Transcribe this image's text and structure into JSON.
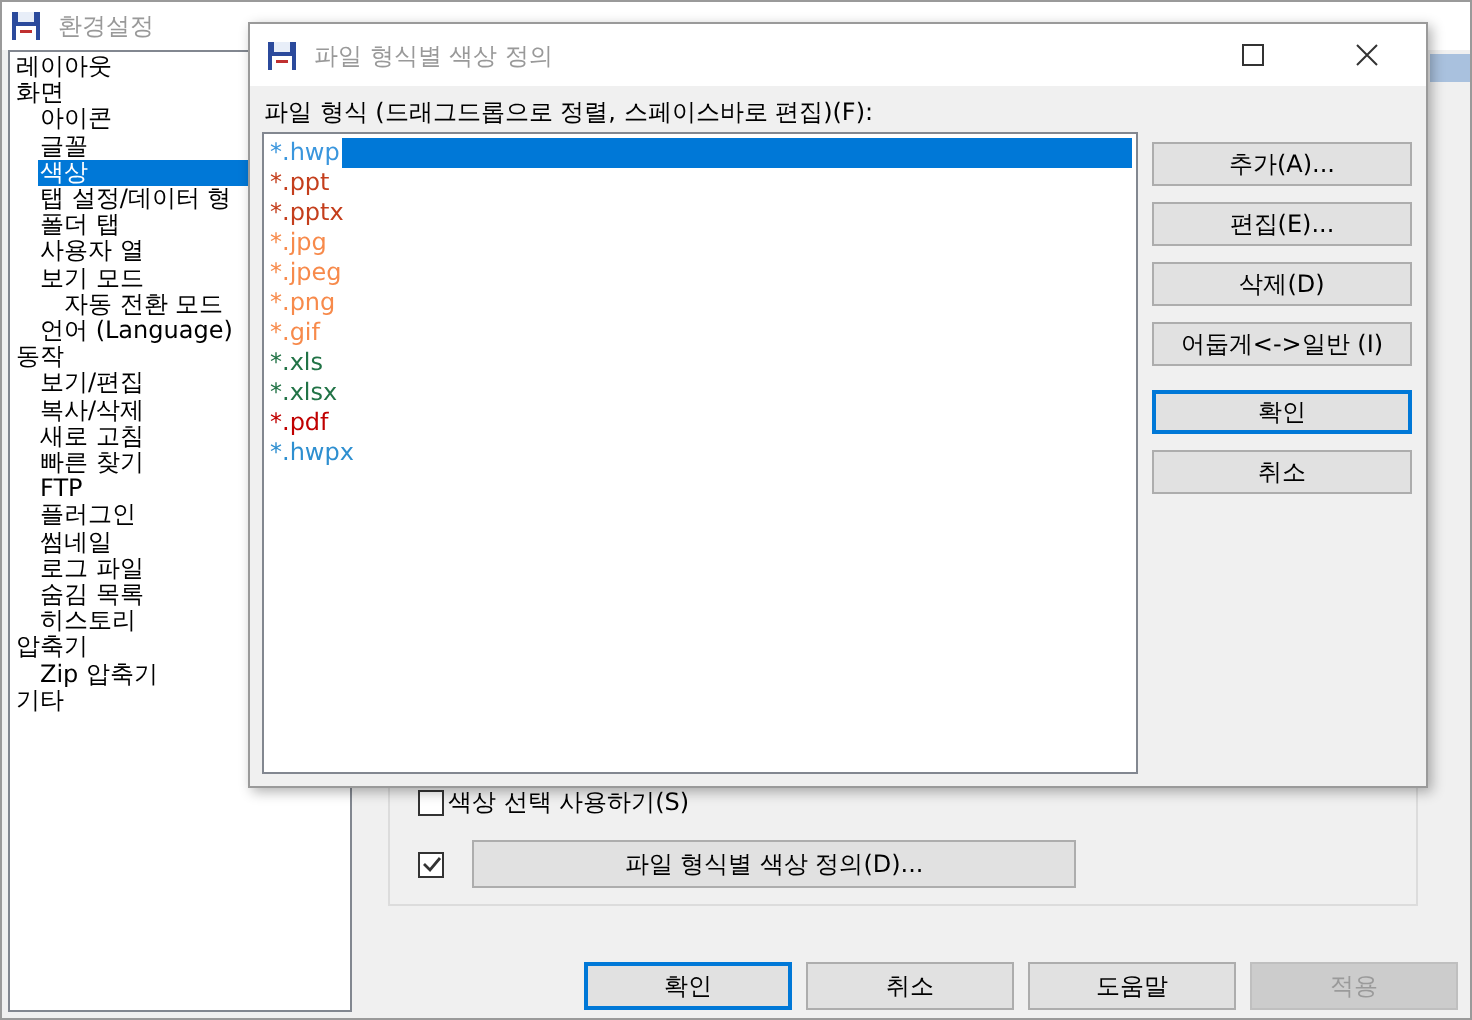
{
  "window": {
    "title": "환경설정"
  },
  "tree": [
    {
      "label": "레이아웃",
      "selected": false
    },
    {
      "label": "화면",
      "selected": false,
      "children": [
        {
          "label": "아이콘",
          "selected": false
        },
        {
          "label": "글꼴",
          "selected": false
        },
        {
          "label": "색상",
          "selected": true
        },
        {
          "label": "탭 설정/데이터 형",
          "selected": false
        },
        {
          "label": "폴더 탭",
          "selected": false
        },
        {
          "label": "사용자 열",
          "selected": false
        },
        {
          "label": "보기 모드",
          "selected": false,
          "children": [
            {
              "label": "자동 전환 모드",
              "selected": false
            }
          ]
        },
        {
          "label": "언어 (Language)",
          "selected": false
        }
      ]
    },
    {
      "label": "동작",
      "selected": false,
      "children": [
        {
          "label": "보기/편집",
          "selected": false
        },
        {
          "label": "복사/삭제",
          "selected": false
        },
        {
          "label": "새로 고침",
          "selected": false
        },
        {
          "label": "빠른 찾기",
          "selected": false
        },
        {
          "label": "FTP",
          "selected": false
        },
        {
          "label": "플러그인",
          "selected": false
        },
        {
          "label": "썸네일",
          "selected": false
        },
        {
          "label": "로그 파일",
          "selected": false
        },
        {
          "label": "숨김 목록",
          "selected": false
        },
        {
          "label": "히스토리",
          "selected": false
        }
      ]
    },
    {
      "label": "압축기",
      "selected": false,
      "children": [
        {
          "label": "Zip 압축기",
          "selected": false
        }
      ]
    },
    {
      "label": "기타",
      "selected": false
    }
  ],
  "options": [
    {
      "label": "색상 선택 사용하기(S)",
      "checked": false
    },
    {
      "label": "파일 형식별 색상 정의(D)...",
      "checked": true
    }
  ],
  "buttons": [
    {
      "label": "확인",
      "focused": true,
      "disabled": false
    },
    {
      "label": "취소",
      "focused": false,
      "disabled": false
    },
    {
      "label": "도움말",
      "focused": false,
      "disabled": false
    },
    {
      "label": "적용",
      "focused": false,
      "disabled": true
    }
  ],
  "dialog": {
    "title": "파일 형식별 색상 정의",
    "list_label": "파일 형식 (드래그드롭으로 정렬, 스페이스바로 편집)(F):",
    "items": [
      {
        "label": "*.hwp",
        "color": "#3a96dd",
        "selected": true
      },
      {
        "label": "*.ppt",
        "color": "#c43e1c",
        "selected": false
      },
      {
        "label": "*.pptx",
        "color": "#c43e1c",
        "selected": false
      },
      {
        "label": "*.jpg",
        "color": "#f78a4b",
        "selected": false
      },
      {
        "label": "*.jpeg",
        "color": "#f78a4b",
        "selected": false
      },
      {
        "label": "*.png",
        "color": "#f78a4b",
        "selected": false
      },
      {
        "label": "*.gif",
        "color": "#f78a4b",
        "selected": false
      },
      {
        "label": "*.xls",
        "color": "#217346",
        "selected": false
      },
      {
        "label": "*.xlsx",
        "color": "#217346",
        "selected": false
      },
      {
        "label": "*.pdf",
        "color": "#c00000",
        "selected": false
      },
      {
        "label": "*.hwpx",
        "color": "#2e8fd0",
        "selected": false
      }
    ],
    "buttons": [
      {
        "label": "추가(A)...",
        "focused": false
      },
      {
        "label": "편집(E)...",
        "focused": false
      },
      {
        "label": "삭제(D)",
        "focused": false
      },
      {
        "label": "어둡게<->일반 (I)",
        "focused": false
      },
      {
        "label": "확인",
        "focused": true
      },
      {
        "label": "취소",
        "focused": false
      }
    ]
  }
}
